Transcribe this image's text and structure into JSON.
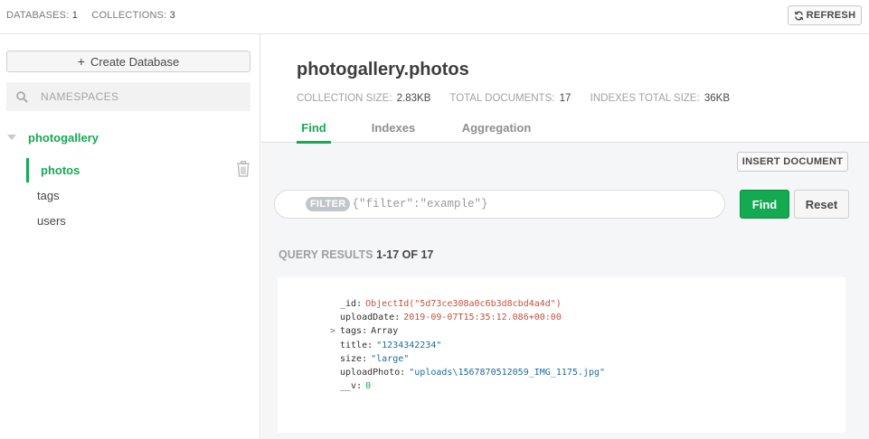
{
  "topbar": {
    "databases_label": "DATABASES:",
    "databases_count": "1",
    "collections_label": "COLLECTIONS:",
    "collections_count": "3",
    "refresh_label": "REFRESH",
    "refresh_icon": "refresh-icon"
  },
  "sidebar": {
    "create_db_label": "Create Database",
    "search_placeholder": "NAMESPACES",
    "search_value": "",
    "database": {
      "name": "photogallery",
      "collections": [
        {
          "name": "photos",
          "active": true
        },
        {
          "name": "tags",
          "active": false
        },
        {
          "name": "users",
          "active": false
        }
      ]
    }
  },
  "main": {
    "title": "photogallery.photos",
    "stats": {
      "size_label": "COLLECTION SIZE:",
      "size_value": "2.83KB",
      "docs_label": "TOTAL DOCUMENTS:",
      "docs_value": "17",
      "indexes_label": "INDEXES TOTAL SIZE:",
      "indexes_value": "36KB"
    },
    "tabs": [
      {
        "label": "Find",
        "active": true
      },
      {
        "label": "Indexes",
        "active": false
      },
      {
        "label": "Aggregation",
        "active": false
      }
    ],
    "insert_label": "INSERT DOCUMENT",
    "filter": {
      "pill": "FILTER",
      "placeholder": "{\"filter\":\"example\"}",
      "value": ""
    },
    "find_label": "Find",
    "reset_label": "Reset",
    "results": {
      "label": "QUERY RESULTS",
      "range": "1-17 OF 17"
    },
    "document": [
      {
        "key": "_id",
        "value": "ObjectId(\"5d73ce308a0c6b3d8cbd4a4d\")",
        "type": "oid"
      },
      {
        "key": "uploadDate",
        "value": "2019-09-07T15:35:12.086+00:00",
        "type": "date"
      },
      {
        "key": "tags",
        "value": "Array",
        "type": "type",
        "expandable": true
      },
      {
        "key": "title",
        "value": "\"1234342234\"",
        "type": "str"
      },
      {
        "key": "size",
        "value": "\"large\"",
        "type": "str"
      },
      {
        "key": "uploadPhoto",
        "value": "\"uploads\\1567870512059_IMG_1175.jpg\"",
        "type": "str"
      },
      {
        "key": "__v",
        "value": "0",
        "type": "num"
      }
    ]
  },
  "colors": {
    "accent": "#13aa52",
    "oid": "#c2533f",
    "string": "#1d6d98"
  }
}
